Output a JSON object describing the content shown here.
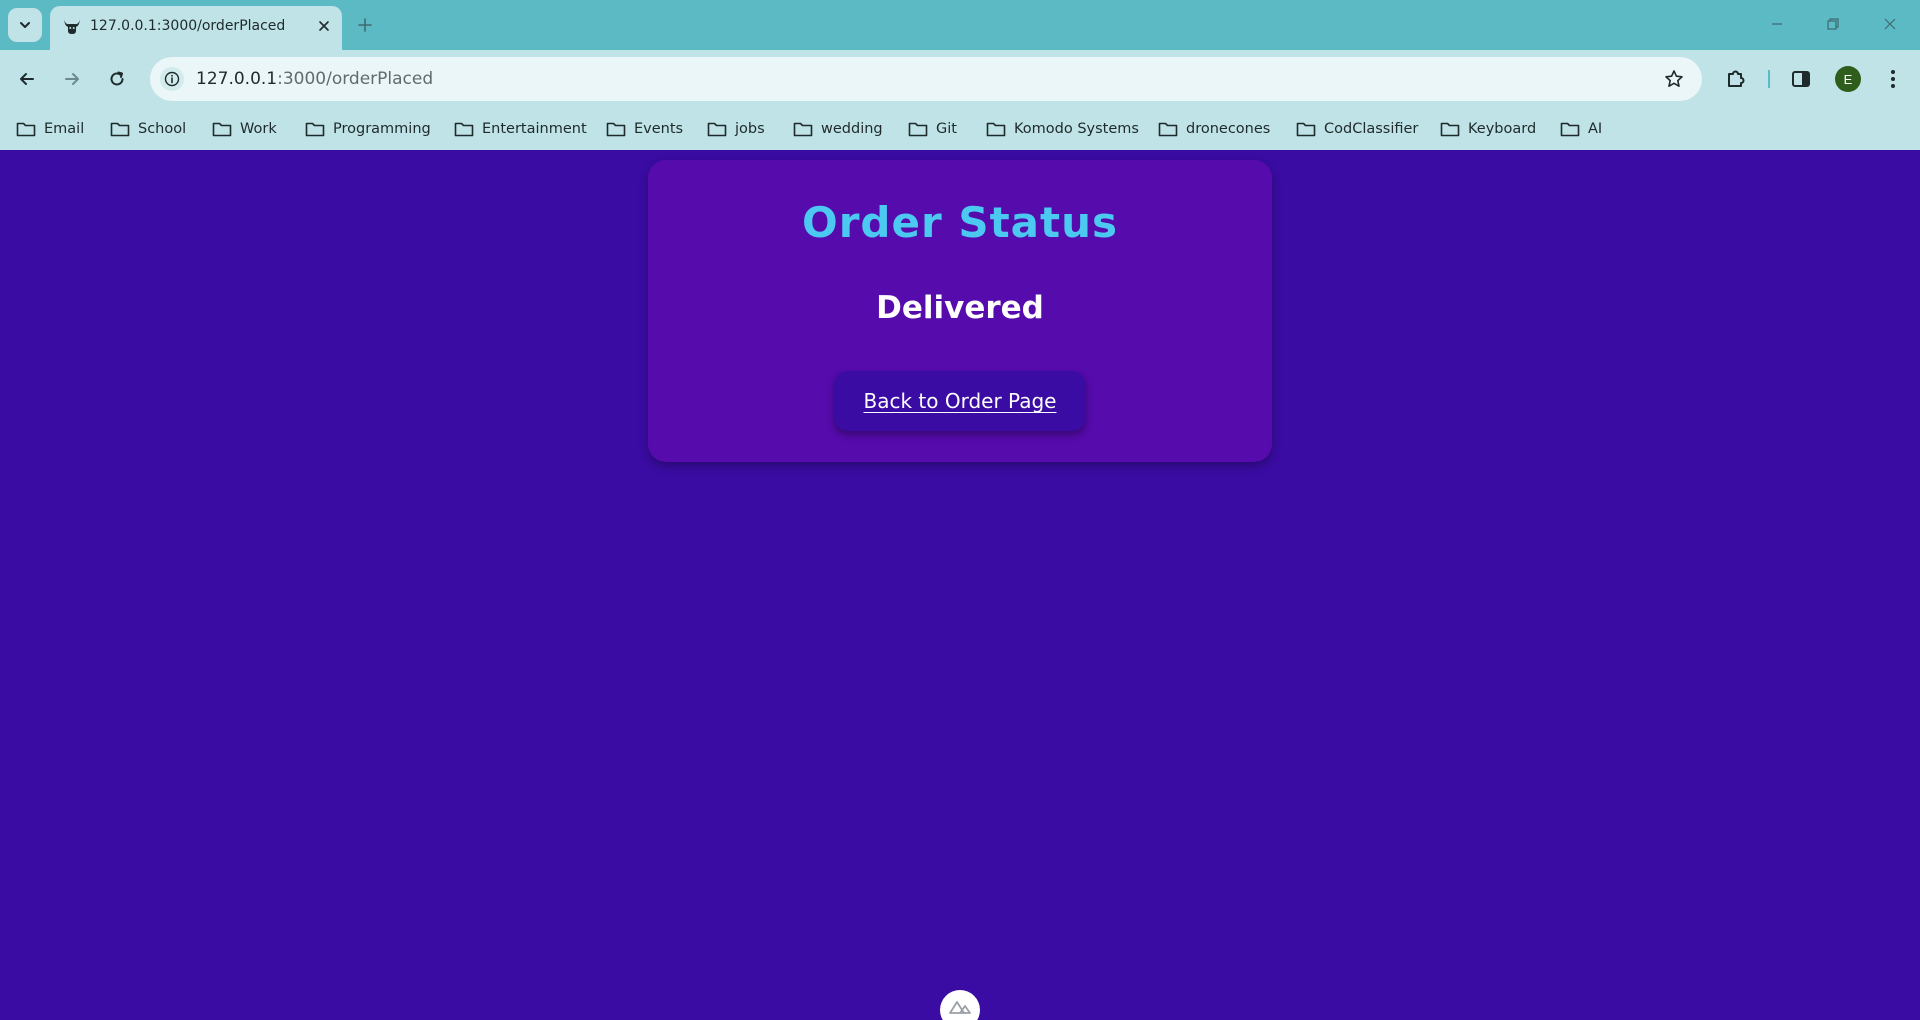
{
  "browser": {
    "tab": {
      "title": "127.0.0.1:3000/orderPlaced",
      "favicon": "ox-head-icon"
    },
    "address_bar": {
      "host": "127.0.0.1",
      "path": ":3000/orderPlaced"
    },
    "profile_initial": "E",
    "bookmarks": [
      {
        "label": "Email",
        "icon": "folder-icon"
      },
      {
        "label": "School",
        "icon": "folder-icon"
      },
      {
        "label": "Work",
        "icon": "folder-icon"
      },
      {
        "label": "Programming",
        "icon": "folder-icon"
      },
      {
        "label": "Entertainment",
        "icon": "folder-icon"
      },
      {
        "label": "Events",
        "icon": "folder-icon"
      },
      {
        "label": "jobs",
        "icon": "folder-icon"
      },
      {
        "label": "wedding",
        "icon": "folder-icon"
      },
      {
        "label": "Git",
        "icon": "folder-icon"
      },
      {
        "label": "Komodo Systems",
        "icon": "folder-icon"
      },
      {
        "label": "dronecones",
        "icon": "folder-icon"
      },
      {
        "label": "CodClassifier",
        "icon": "folder-icon"
      },
      {
        "label": "Keyboard",
        "icon": "folder-icon"
      },
      {
        "label": "AI",
        "icon": "folder-icon"
      }
    ]
  },
  "page": {
    "title": "Order Status",
    "status": "Delivered",
    "back_button_label": "Back to Order Page"
  },
  "colors": {
    "page_background": "#3a0ca3",
    "card_background": "#560bad",
    "title_color": "#4cc9f0",
    "chrome_accent": "#5bbac4",
    "chrome_surface": "#bfe3e6"
  }
}
